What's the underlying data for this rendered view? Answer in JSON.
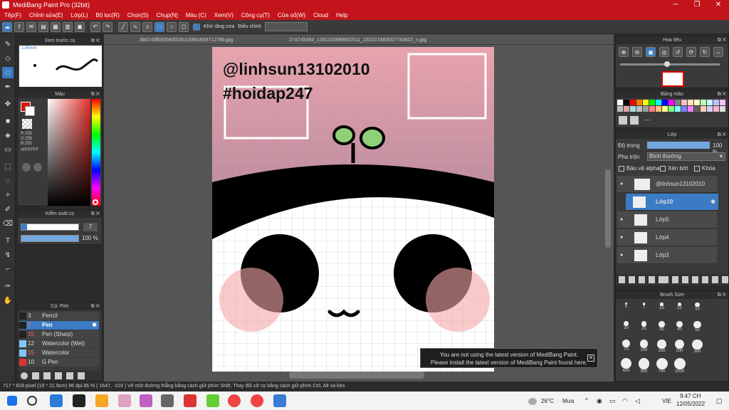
{
  "window": {
    "title": "MediBang Paint Pro (32bit)"
  },
  "menu": [
    "Tệp(F)",
    "Chỉnh sửa(E)",
    "Lớp(L)",
    "Bộ lọc(R)",
    "Chọn(S)",
    "Chụp(N)",
    "Màu (C)",
    "Xem(V)",
    "Công cụ(T)",
    "Cửa sổ(W)",
    "Cloud",
    "Help"
  ],
  "toolbar": {
    "antialias_label": "Khử răng cưa",
    "adjust_label": "Điều chỉnh"
  },
  "preview_panel": {
    "title": "Xem trước cọ",
    "size_label": "1.85mm"
  },
  "color_panel": {
    "title": "Màu",
    "r": "R:255",
    "g": "G:255",
    "b": "B:255",
    "hex": "#FFFFFF",
    "primary": "#d9140f",
    "secondary": "#ffffff"
  },
  "brush_control": {
    "title": "Kiểm soát cọ",
    "size_value": "7",
    "opacity_value": "100 %"
  },
  "brush_panel": {
    "title": "Cọ: Pen",
    "items": [
      {
        "size": "3",
        "name": "Pencil"
      },
      {
        "size": "7",
        "name": "Pen"
      },
      {
        "size": "15",
        "name": "Pen (Sharp)"
      },
      {
        "size": "12",
        "name": "Watercolor (Wet)"
      },
      {
        "size": "15",
        "name": "Watercolor"
      },
      {
        "size": "10",
        "name": "G Pen"
      }
    ]
  },
  "tabs": [
    "380743fb93583f3261c580c65971278b.jpg",
    "274745493_1261103999832511_232221983007743602_n.jpg"
  ],
  "canvas_text": {
    "line1": "@linhsun13102010",
    "line2": "#hoidap247"
  },
  "message": {
    "line1": "You are not using the latest version of MediBang Paint.",
    "line2": "Please install the latest version of MediBang Paint found here."
  },
  "navigator": {
    "title": "Hoa tiêu"
  },
  "palette": {
    "title": "Bảng màu",
    "empty_label": "---",
    "colors": [
      "#ffffff",
      "#000000",
      "#ff0000",
      "#ff8000",
      "#ffff00",
      "#00ff00",
      "#00ffff",
      "#0000ff",
      "#ff00ff",
      "#808080",
      "#ffc0c0",
      "#ffe0c0",
      "#ffffc0",
      "#c0ffc0",
      "#c0ffff",
      "#c0c0ff",
      "#ffc0ff",
      "#c0c0c0",
      "#e0a0a0",
      "#a0e0e0",
      "#c0c0c0",
      "#a0a0a0",
      "#ff8080",
      "#ffc080",
      "#ffff80",
      "#80ff80",
      "#80ffff",
      "#8080ff",
      "#ff80ff",
      "#606060",
      "#ffd0b0",
      "#d0d0ff",
      "#ffb0d0",
      "#e0e0e0"
    ]
  },
  "layer_panel": {
    "title": "Lớp",
    "opacity_label": "Độ trong",
    "opacity_value": "100 %",
    "blend_label": "Pha trộn",
    "blend_value": "Bình thường",
    "protect_alpha": "Bảo vệ alpha",
    "clip": "Xén bớt",
    "lock": "Khóa",
    "layers": [
      "@linhsun13102010",
      "Lớp10",
      "Lớp5",
      "Lớp4",
      "Lớp3"
    ]
  },
  "brush_size": {
    "title": "Brush Size",
    "sizes": [
      "5",
      "7",
      "10",
      "12",
      "15",
      "20",
      "25",
      "30",
      "40",
      "50",
      "70",
      "100",
      "150",
      "200",
      "300",
      "400",
      "500",
      "700",
      "1000"
    ]
  },
  "status": {
    "text": "717 * 828 pixel   (19 * 21.9cm)   96 dpi   86 %   ( 1647, -319 )   Vẽ một đường thẳng bằng cách giữ phím Shift, Thay đổi cỡ cọ bằng cách giữ phím Ctrl, Alt và kéo"
  },
  "taskbar": {
    "temperature": "26°C",
    "weather": "Mưa",
    "lang": "VIE",
    "time": "9:47 CH",
    "date": "12/05/2022"
  }
}
